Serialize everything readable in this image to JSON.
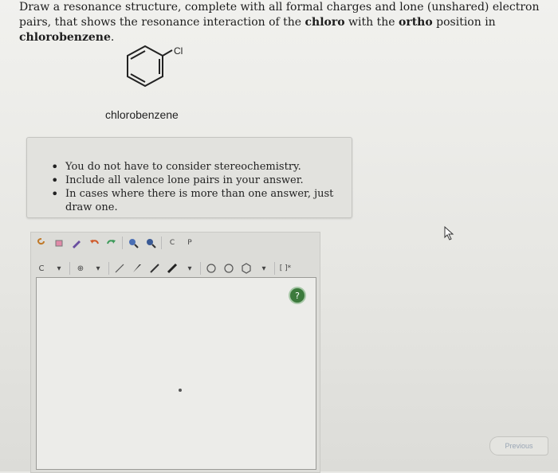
{
  "question": {
    "part1": "Draw a resonance structure, complete with all formal charges and lone (unshared) electron pairs, that shows the resonance interaction of the ",
    "bold1": "chloro",
    "part2": " with the ",
    "bold2": "ortho",
    "part3": " position in ",
    "bold3": "chlorobenzene",
    "part4": "."
  },
  "molecule": {
    "substituent_label": "Cl",
    "name": "chlorobenzene"
  },
  "hints": [
    "You do not have to consider stereochemistry.",
    "Include all valence lone pairs in your answer.",
    "In cases where there is more than one answer, just draw one."
  ],
  "toolbar": {
    "row1": [
      "select-lasso-icon",
      "erase-icon",
      "pencil-icon",
      "undo-icon",
      "redo-icon",
      "zoom-in-icon",
      "zoom-out-icon",
      "C-label",
      "P-label"
    ],
    "atom_label": "C",
    "c_label": "C",
    "p_label": "P",
    "bracket_label": "[ ]*"
  },
  "help": {
    "label": "?"
  },
  "nav": {
    "previous_label": "Previous"
  }
}
